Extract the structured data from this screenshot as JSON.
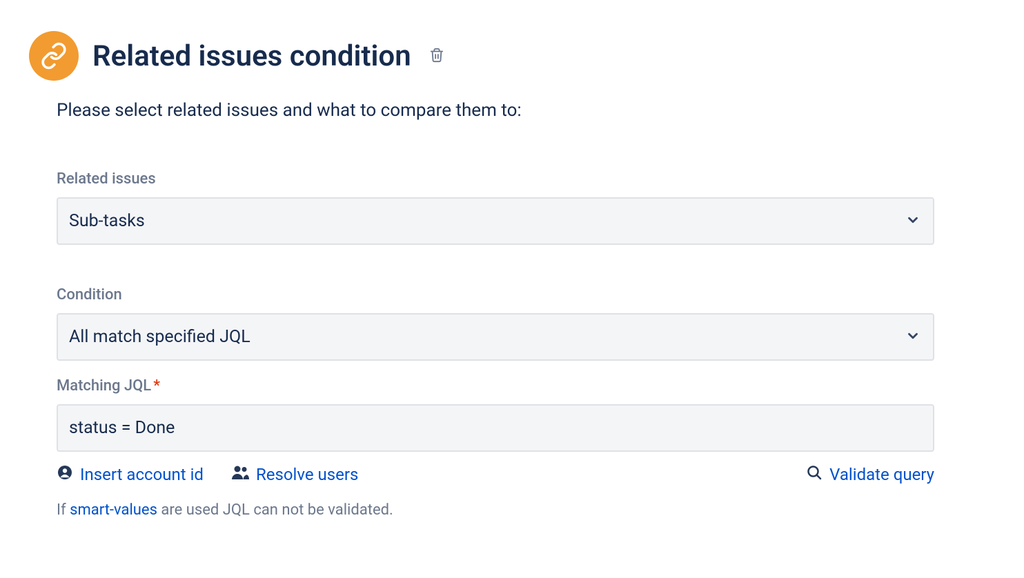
{
  "header": {
    "title": "Related issues condition"
  },
  "description": "Please select related issues and what to compare them to:",
  "fields": {
    "relatedIssues": {
      "label": "Related issues",
      "value": "Sub-tasks"
    },
    "condition": {
      "label": "Condition",
      "value": "All match specified JQL"
    },
    "matchingJql": {
      "label": "Matching JQL",
      "value": "status = Done"
    }
  },
  "actions": {
    "insertAccountId": "Insert account id",
    "resolveUsers": "Resolve users",
    "validateQuery": "Validate query"
  },
  "hint": {
    "prefix": "If ",
    "link": "smart-values",
    "suffix": " are used JQL can not be validated."
  }
}
